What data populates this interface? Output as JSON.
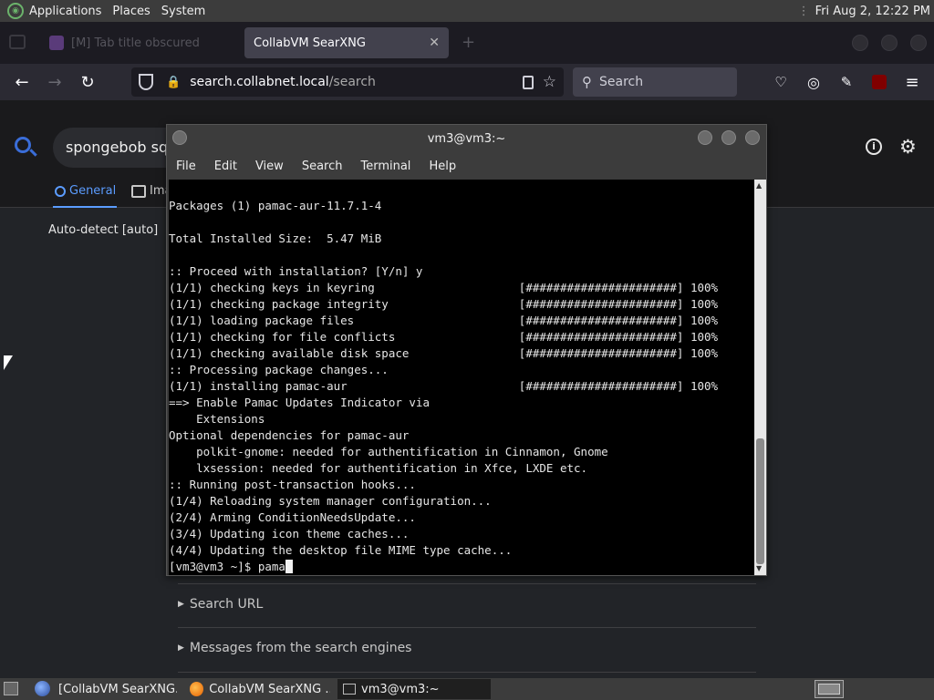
{
  "top_panel": {
    "applications": "Applications",
    "places": "Places",
    "system": "System",
    "clock": "Fri Aug  2, 12:22 PM"
  },
  "browser": {
    "tabs": [
      {
        "label": "[M] Tab title obscured"
      },
      {
        "label": "CollabVM SearXNG"
      }
    ],
    "url_host": "search.collabnet.local",
    "url_path": "/search",
    "search_placeholder": "Search"
  },
  "searx": {
    "query": "spongebob squa",
    "categories": [
      {
        "label": "General"
      },
      {
        "label": "Ima"
      }
    ],
    "autodetect": "Auto-detect [auto]",
    "search_url": "Search URL",
    "messages": "Messages from the search engines"
  },
  "terminal": {
    "title": "vm3@vm3:~",
    "menu": [
      "File",
      "Edit",
      "View",
      "Search",
      "Terminal",
      "Help"
    ],
    "lines": [
      "Packages (1) pamac-aur-11.7.1-4",
      "",
      "Total Installed Size:  5.47 MiB",
      "",
      ":: Proceed with installation? [Y/n] y",
      "(1/1) checking keys in keyring                     [######################] 100%",
      "(1/1) checking package integrity                   [######################] 100%",
      "(1/1) loading package files                        [######################] 100%",
      "(1/1) checking for file conflicts                  [######################] 100%",
      "(1/1) checking available disk space                [######################] 100%",
      ":: Processing package changes...",
      "(1/1) installing pamac-aur                         [######################] 100%",
      "==> Enable Pamac Updates Indicator via",
      "    Extensions",
      "Optional dependencies for pamac-aur",
      "    polkit-gnome: needed for authentification in Cinnamon, Gnome",
      "    lxsession: needed for authentification in Xfce, LXDE etc.",
      ":: Running post-transaction hooks...",
      "(1/4) Reloading system manager configuration...",
      "(2/4) Arming ConditionNeedsUpdate...",
      "(3/4) Updating icon theme caches...",
      "(4/4) Updating the desktop file MIME type cache..."
    ],
    "prompt": "[vm3@vm3 ~]$ ",
    "input": "pama"
  },
  "taskbar": {
    "items": [
      {
        "label": "[CollabVM SearXNG..."
      },
      {
        "label": "CollabVM SearXNG ..."
      },
      {
        "label": "vm3@vm3:~"
      }
    ]
  }
}
